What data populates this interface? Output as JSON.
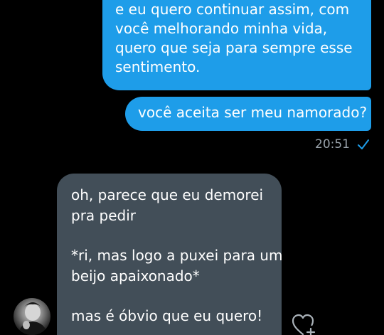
{
  "chat": {
    "outgoing": [
      {
        "lines": [
          "e eu quero continuar assim, com",
          "você melhorando minha vida,",
          "quero que seja para sempre esse",
          "sentimento."
        ]
      },
      {
        "lines": [
          "você aceita ser meu namorado?"
        ]
      }
    ],
    "timestamp": "20:51",
    "incoming": {
      "paragraphs": [
        "oh, parece que eu demorei\npra pedir",
        "*ri, mas logo a puxei para um\nbeijo apaixonado*",
        "mas é óbvio que eu quero!"
      ]
    }
  },
  "colors": {
    "background": "#000000",
    "outgoing_bubble": "#1e9de9",
    "incoming_bubble": "#424e58",
    "timestamp": "#9aa3ab",
    "check": "#1e9de9"
  },
  "icons": {
    "read_receipt": "check-icon",
    "react": "heart-plus-icon"
  }
}
